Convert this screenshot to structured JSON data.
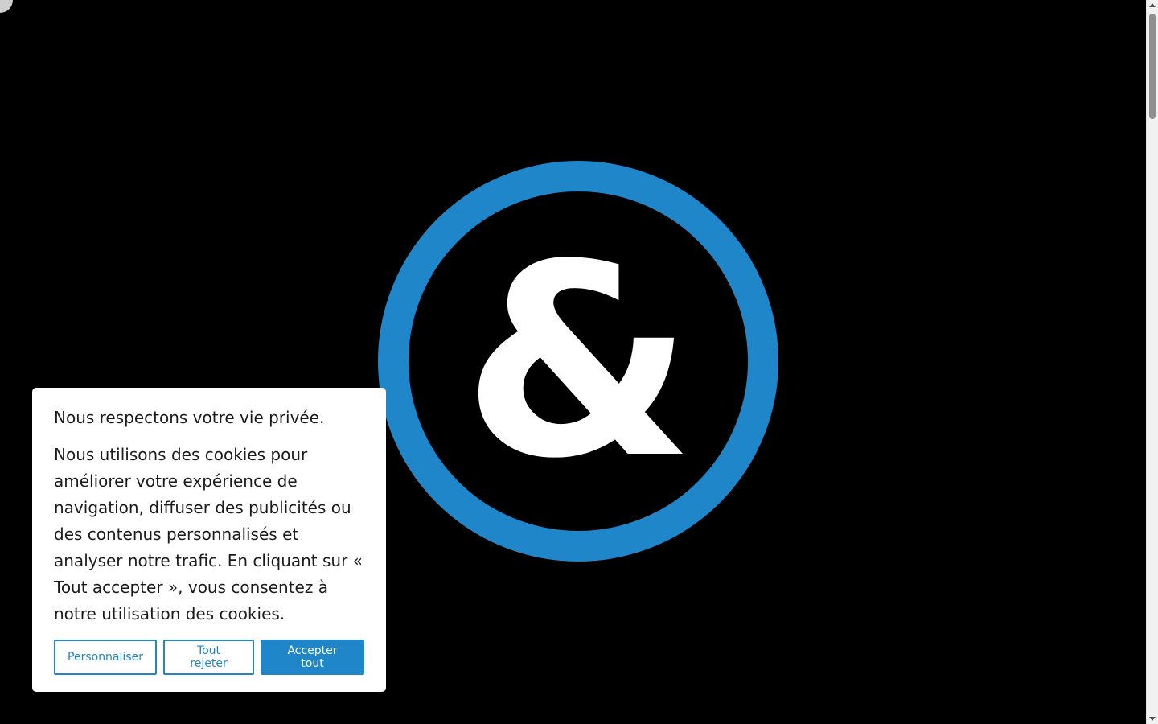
{
  "logo": {
    "icon": "ampersand-circle-logo",
    "glyph": "&",
    "ring_color": "#1f87c9",
    "glyph_color": "#ffffff",
    "background": "#000000"
  },
  "cookie_banner": {
    "title": "Nous respectons votre vie privée.",
    "body": "Nous utilisons des cookies pour améliorer votre expérience de navigation, diffuser des publicités ou des contenus personnalisés et analyser notre trafic. En cliquant sur « Tout accepter », vous consentez à notre utilisation des cookies.",
    "buttons": {
      "customize": "Personnaliser",
      "reject_all": "Tout rejeter",
      "accept_all": "Accepter tout"
    },
    "accent_color": "#1f87c9"
  }
}
